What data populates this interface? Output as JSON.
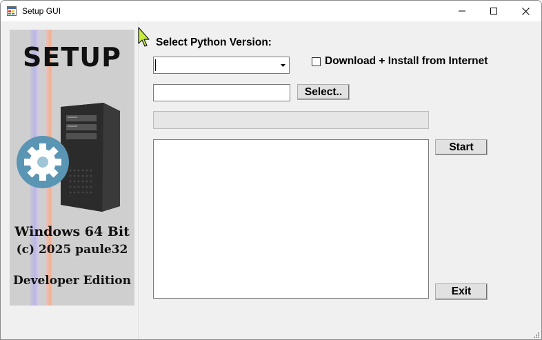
{
  "window": {
    "title": "Setup GUI",
    "controls": {
      "minimize": "minimize-icon",
      "maximize": "maximize-icon",
      "close": "close-icon"
    }
  },
  "banner": {
    "heading": "SETUP",
    "line1": "Windows 64 Bit",
    "line2": "(c) 2025 paule32",
    "line3": "Developer Edition",
    "icons": [
      "computer-tower-icon",
      "gear-icon"
    ],
    "colors": {
      "gear": "#4f8fb0",
      "tower": "#2a2a2a"
    }
  },
  "form": {
    "python_version_label": "Select Python Version:",
    "python_version_value": "",
    "download_checkbox_label": "Download + Install from Internet",
    "download_checked": false,
    "path_value": "",
    "select_button": "Select..",
    "progress": 0,
    "log_text": "",
    "start_button": "Start",
    "exit_button": "Exit"
  }
}
